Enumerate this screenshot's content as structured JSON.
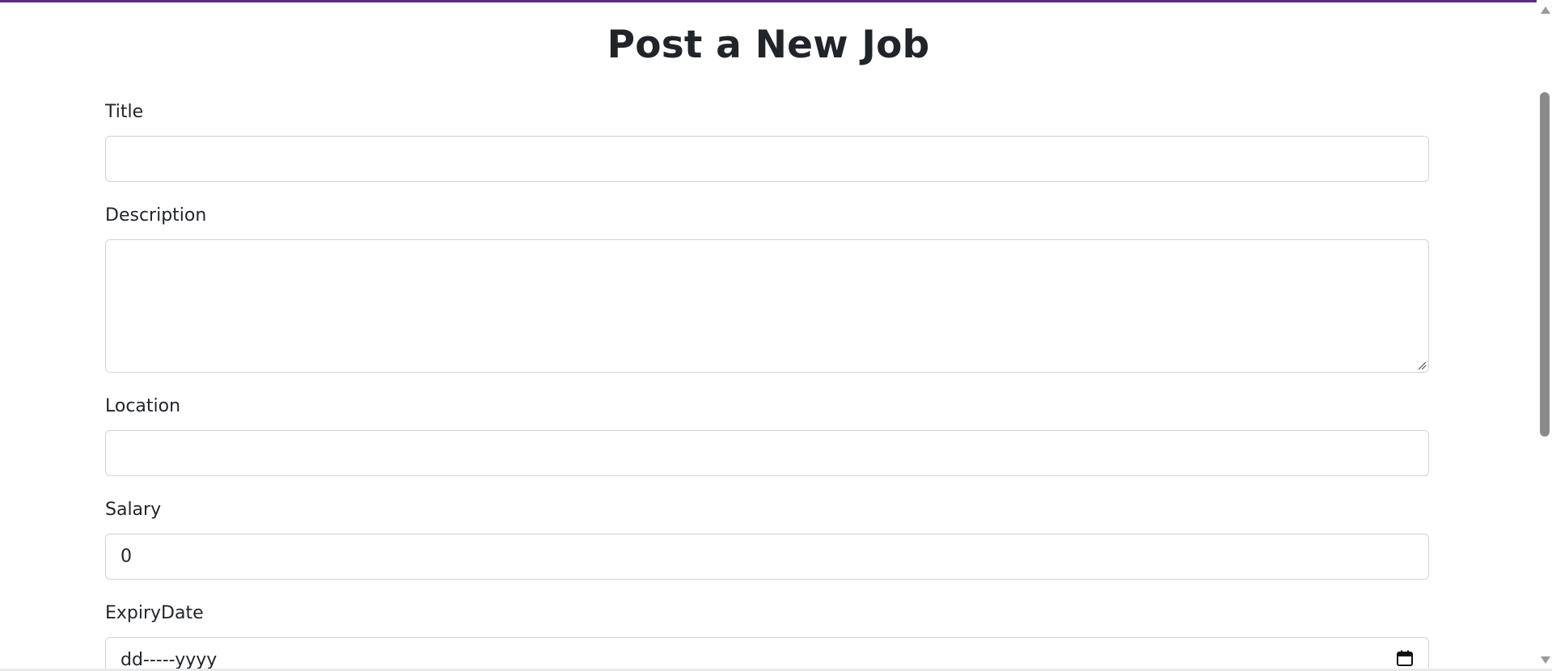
{
  "page": {
    "title": "Post a New Job"
  },
  "form": {
    "title": {
      "label": "Title",
      "value": ""
    },
    "description": {
      "label": "Description",
      "value": ""
    },
    "location": {
      "label": "Location",
      "value": ""
    },
    "salary": {
      "label": "Salary",
      "value": "0"
    },
    "expiry_date": {
      "label": "ExpiryDate",
      "value": "dd-----yyyy"
    }
  },
  "colors": {
    "accent": "#5b2b82",
    "border": "#ced4da",
    "text": "#212529"
  },
  "icons": {
    "calendar": "calendar-icon",
    "resize": "resize-grip-icon"
  }
}
